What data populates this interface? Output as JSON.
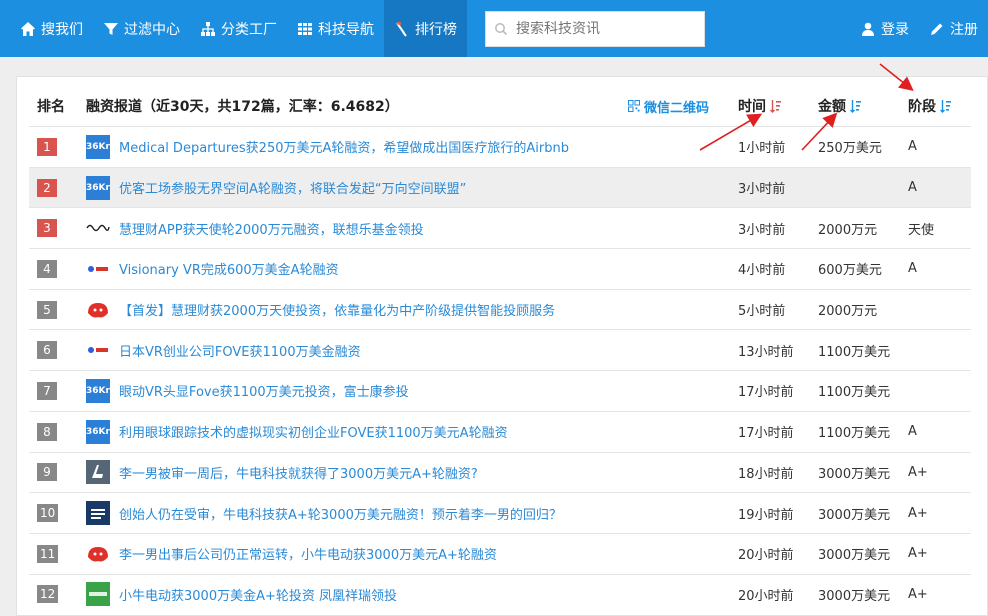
{
  "nav": {
    "items": [
      {
        "label": "搜我们",
        "icon": "home-icon"
      },
      {
        "label": "过滤中心",
        "icon": "filter-icon"
      },
      {
        "label": "分类工厂",
        "icon": "sitemap-icon"
      },
      {
        "label": "科技导航",
        "icon": "grid-icon"
      },
      {
        "label": "排行榜",
        "icon": "ranking-icon"
      }
    ],
    "search_placeholder": "搜索科技资讯",
    "login": "登录",
    "register": "注册"
  },
  "table": {
    "header": {
      "rank": "排名",
      "title": "融资报道（近30天，共172篇，汇率：6.4682）",
      "wechat": "微信二维码",
      "time": "时间",
      "amount": "金额",
      "stage": "阶段"
    },
    "rows": [
      {
        "rank": "1",
        "logo": "36kr",
        "title": "Medical Departures获250万美元A轮融资，希望做成出国医疗旅行的Airbnb",
        "time": "1小时前",
        "amount": "250万美元",
        "stage": "A"
      },
      {
        "rank": "2",
        "logo": "36kr",
        "title": "优客工场参股无界空间A轮融资，将联合发起“万向空间联盟”",
        "time": "3小时前",
        "amount": "",
        "stage": "A"
      },
      {
        "rank": "3",
        "logo": "site",
        "title": "慧理财APP获天使轮2000万元融资，联想乐基金领投",
        "time": "3小时前",
        "amount": "2000万元",
        "stage": "天使"
      },
      {
        "rank": "4",
        "logo": "baidu",
        "title": "Visionary VR完成600万美金A轮融资",
        "time": "4小时前",
        "amount": "600万美元",
        "stage": "A"
      },
      {
        "rank": "5",
        "logo": "tiger",
        "title": "【首发】慧理财获2000万天使投资，依靠量化为中产阶级提供智能投顾服务",
        "time": "5小时前",
        "amount": "2000万元",
        "stage": ""
      },
      {
        "rank": "6",
        "logo": "baidu",
        "title": "日本VR创业公司FOVE获1100万美金融资",
        "time": "13小时前",
        "amount": "1100万美元",
        "stage": ""
      },
      {
        "rank": "7",
        "logo": "36kr",
        "title": "眼动VR头显Fove获1100万美元投资，富士康参投",
        "time": "17小时前",
        "amount": "1100万美元",
        "stage": ""
      },
      {
        "rank": "8",
        "logo": "36kr",
        "title": "利用眼球跟踪技术的虚拟现实初创企业FOVE获1100万美元A轮融资",
        "time": "17小时前",
        "amount": "1100万美元",
        "stage": "A"
      },
      {
        "rank": "9",
        "logo": "fengxiu",
        "title": "李一男被审一周后，牛电科技就获得了3000万美元A+轮融资?",
        "time": "18小时前",
        "amount": "3000万美元",
        "stage": "A+"
      },
      {
        "rank": "10",
        "logo": "tzj",
        "title": "创始人仍在受审，牛电科技获A+轮3000万美元融资！预示着李一男的回归？",
        "time": "19小时前",
        "amount": "3000万美元",
        "stage": "A+"
      },
      {
        "rank": "11",
        "logo": "tiger",
        "title": "李一男出事后公司仍正常运转，小牛电动获3000万美元A+轮融资",
        "time": "20小时前",
        "amount": "3000万美元",
        "stage": "A+"
      },
      {
        "rank": "12",
        "logo": "donews",
        "title": "小牛电动获3000万美金A+轮投资 凤凰祥瑞领投",
        "time": "20小时前",
        "amount": "3000万美元",
        "stage": "A+"
      }
    ]
  },
  "colors": {
    "navbar": "#1d8fe0",
    "navbar_active": "#1678c2",
    "link": "#2a8ad6",
    "top_badge": "#d9534f",
    "gray_badge": "#888888",
    "annotation_arrow": "#e02020"
  }
}
